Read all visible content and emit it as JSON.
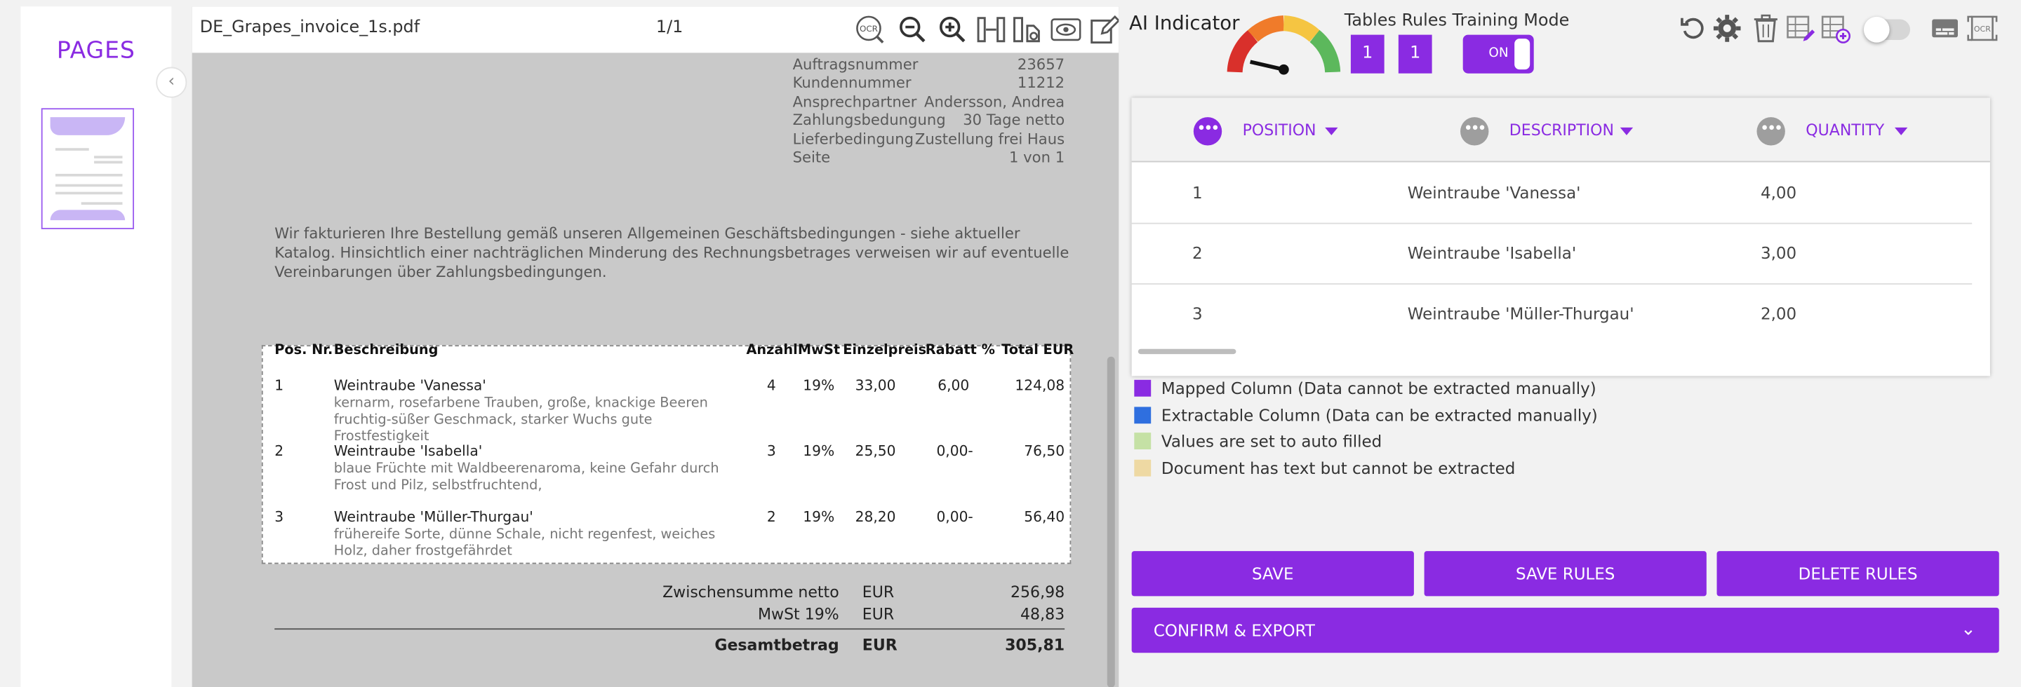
{
  "sidebar": {
    "title": "PAGES",
    "collapse_icon": "chevron-left"
  },
  "viewer": {
    "file_name": "DE_Grapes_invoice_1s.pdf",
    "page_counter": "1/1",
    "tools": [
      "ocr-icon",
      "zoom-out-icon",
      "zoom-in-icon",
      "fit-width-icon",
      "rotate-page-icon",
      "eye-icon",
      "edit-icon"
    ],
    "ocr_label": "OCR"
  },
  "document": {
    "meta": [
      {
        "label": "Auftragsnummer",
        "value": "23657"
      },
      {
        "label": "Kundennummer",
        "value": "11212"
      },
      {
        "label": "Ansprechpartner",
        "value": "Andersson, Andrea"
      },
      {
        "label": "Zahlungsbedungung",
        "value": "30 Tage netto"
      },
      {
        "label": "Lieferbedingung",
        "value": "Zustellung frei Haus"
      },
      {
        "label": "Seite",
        "value": "1 von 1"
      }
    ],
    "intro": "Wir fakturieren Ihre Bestellung gemäß unseren Allgemeinen Geschäftsbedingungen - siehe aktueller Katalog. Hinsichtlich einer nachträglichen Minderung des Rechnungsbetrages verweisen wir auf eventuelle Vereinbarungen über Zahlungsbedingungen.",
    "table_headers": {
      "pos": "Pos. Nr.",
      "desc": "Beschreibung",
      "qty": "Anzahl",
      "vat": "MwSt",
      "unit": "Einzelpreis",
      "discount": "Rabatt %",
      "total": "Total EUR"
    },
    "rows": [
      {
        "pos": "1",
        "name": "Weintraube 'Vanessa'",
        "detail": "kernarm, rosefarbene Trauben, große, knackige Beeren fruchtig-süßer Geschmack, starker Wuchs gute Frostfestigkeit",
        "qty": "4",
        "vat": "19%",
        "unit": "33,00",
        "discount": "6,00",
        "total": "124,08"
      },
      {
        "pos": "2",
        "name": "Weintraube 'Isabella'",
        "detail": "blaue Früchte mit Waldbeerenaroma, keine Gefahr durch Frost und Pilz, selbstfruchtend,",
        "qty": "3",
        "vat": "19%",
        "unit": "25,50",
        "discount": "0,00-",
        "total": "76,50"
      },
      {
        "pos": "3",
        "name": "Weintraube 'Müller-Thurgau'",
        "detail": "frühereife Sorte, dünne Schale, nicht regenfest, weiches Holz, daher frostgefährdet",
        "qty": "2",
        "vat": "19%",
        "unit": "28,20",
        "discount": "0,00-",
        "total": "56,40"
      }
    ],
    "totals": {
      "subtotal_label": "Zwischensumme netto",
      "subtotal_currency": "EUR",
      "subtotal_value": "256,98",
      "vat_label": "MwSt 19%",
      "vat_currency": "EUR",
      "vat_value": "48,83",
      "grand_label": "Gesamtbetrag",
      "grand_currency": "EUR",
      "grand_value": "305,81"
    }
  },
  "right": {
    "ai_indicator_label": "AI Indicator",
    "mode_header": "Tables Rules Training Mode",
    "tables_count": "1",
    "rules_count": "1",
    "training_toggle": "ON",
    "toolbar_icons": [
      "undo-icon",
      "settings-icon",
      "trash-icon",
      "table-edit-icon",
      "table-add-icon",
      "toggle-switch",
      "subtitles-icon",
      "ocr-doc-icon"
    ],
    "columns": [
      {
        "title": "POSITION",
        "dot_color": "#8a2be2"
      },
      {
        "title": "DESCRIPTION",
        "dot_color": "#9e9e9e"
      },
      {
        "title": "QUANTITY",
        "dot_color": "#9e9e9e"
      }
    ],
    "rows": [
      {
        "position": "1",
        "description": "Weintraube 'Vanessa'",
        "quantity": "4,00"
      },
      {
        "position": "2",
        "description": "Weintraube 'Isabella'",
        "quantity": "3,00"
      },
      {
        "position": "3",
        "description": "Weintraube 'Müller-Thurgau'",
        "quantity": "2,00"
      }
    ],
    "legend": [
      {
        "color": "#8a2be2",
        "text": "Mapped Column (Data cannot be extracted manually)"
      },
      {
        "color": "#2f6fdf",
        "text": "Extractable Column (Data can be extracted manually)"
      },
      {
        "color": "#c5e1a5",
        "text": "Values are set to auto filled"
      },
      {
        "color": "#eed9a3",
        "text": "Document has text but cannot be extracted"
      }
    ],
    "buttons": {
      "save": "SAVE",
      "save_rules": "SAVE RULES",
      "delete_rules": "DELETE RULES",
      "confirm_export": "CONFIRM & EXPORT"
    },
    "accent_color": "#8a2be2"
  }
}
